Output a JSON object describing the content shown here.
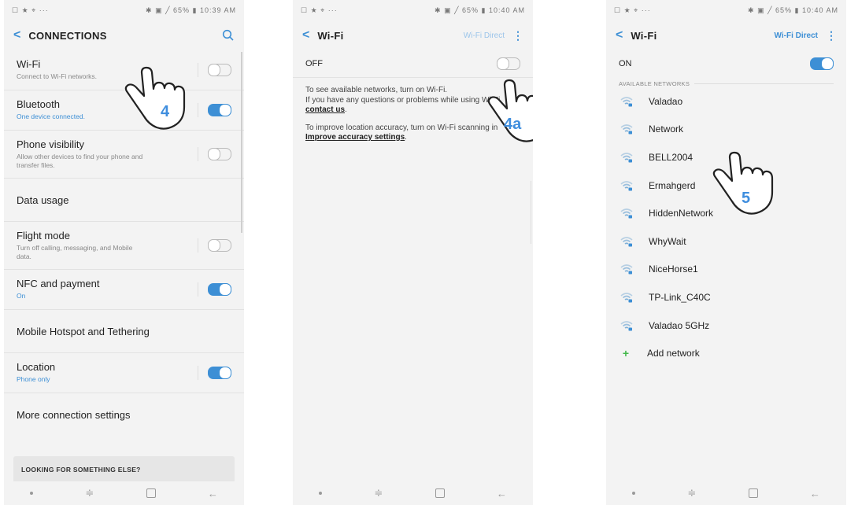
{
  "status_bar": {
    "p1_left": "☐ ★ ⌖  ···",
    "p1_right": "✱ ▣ ╱ 65% ▮ 10:39 AM",
    "p2_left": "☐ ★ ⌖  ···",
    "p2_right": "✱ ▣ ╱ 65% ▮ 10:40 AM",
    "p3_left": "☐ ★ ⌖  ···",
    "p3_right": "✱ ▣ ╱ 65% ▮ 10:40 AM"
  },
  "connections": {
    "title": "CONNECTIONS",
    "back_glyph": "<",
    "items": [
      {
        "title": "Wi-Fi",
        "subtitle": "Connect to Wi-Fi networks.",
        "toggle": "off"
      },
      {
        "title": "Bluetooth",
        "subtitle": "One device connected.",
        "toggle": "on"
      },
      {
        "title": "Phone visibility",
        "subtitle": "Allow other devices to find your phone and transfer files.",
        "toggle": "off"
      },
      {
        "title": "Data usage"
      },
      {
        "title": "Flight mode",
        "subtitle": "Turn off calling, messaging, and Mobile data.",
        "toggle": "off"
      },
      {
        "title": "NFC and payment",
        "subtitle": "On",
        "toggle": "on"
      },
      {
        "title": "Mobile Hotspot and Tethering"
      },
      {
        "title": "Location",
        "subtitle": "Phone only",
        "toggle": "on"
      },
      {
        "title": "More connection settings"
      }
    ],
    "looking_for": "LOOKING FOR SOMETHING ELSE?"
  },
  "wifi_off": {
    "title": "Wi-Fi",
    "wifi_direct": "Wi-Fi Direct",
    "kebab": "⋮",
    "state_label": "OFF",
    "info1_a": "To see available networks, turn on Wi-Fi.",
    "info1_b": "If you have any questions or problems while using Wi-Fi,",
    "info1_link": "contact us",
    "info1_end": ".",
    "info2_a": "To improve location accuracy, turn on Wi-Fi scanning in",
    "info2_link": "Improve accuracy settings",
    "info2_end": "."
  },
  "wifi_on": {
    "title": "Wi-Fi",
    "wifi_direct": "Wi-Fi Direct",
    "kebab": "⋮",
    "state_label": "ON",
    "section_header": "AVAILABLE NETWORKS",
    "networks": [
      "Valadao",
      "Network",
      "BELL2004",
      "Ermahgerd",
      "HiddenNetwork",
      "WhyWait",
      "NiceHorse1",
      "TP-Link_C40C",
      "Valadao 5GHz"
    ],
    "add_network": "Add network",
    "add_glyph": "+"
  },
  "steps": {
    "s1": "4",
    "s2": "4a",
    "s3": "5"
  },
  "navbar": {
    "recents": "≑",
    "back": "←"
  },
  "colors": {
    "accent": "#3d8fd5",
    "step": "#3f8ede",
    "add": "#42b84a"
  }
}
